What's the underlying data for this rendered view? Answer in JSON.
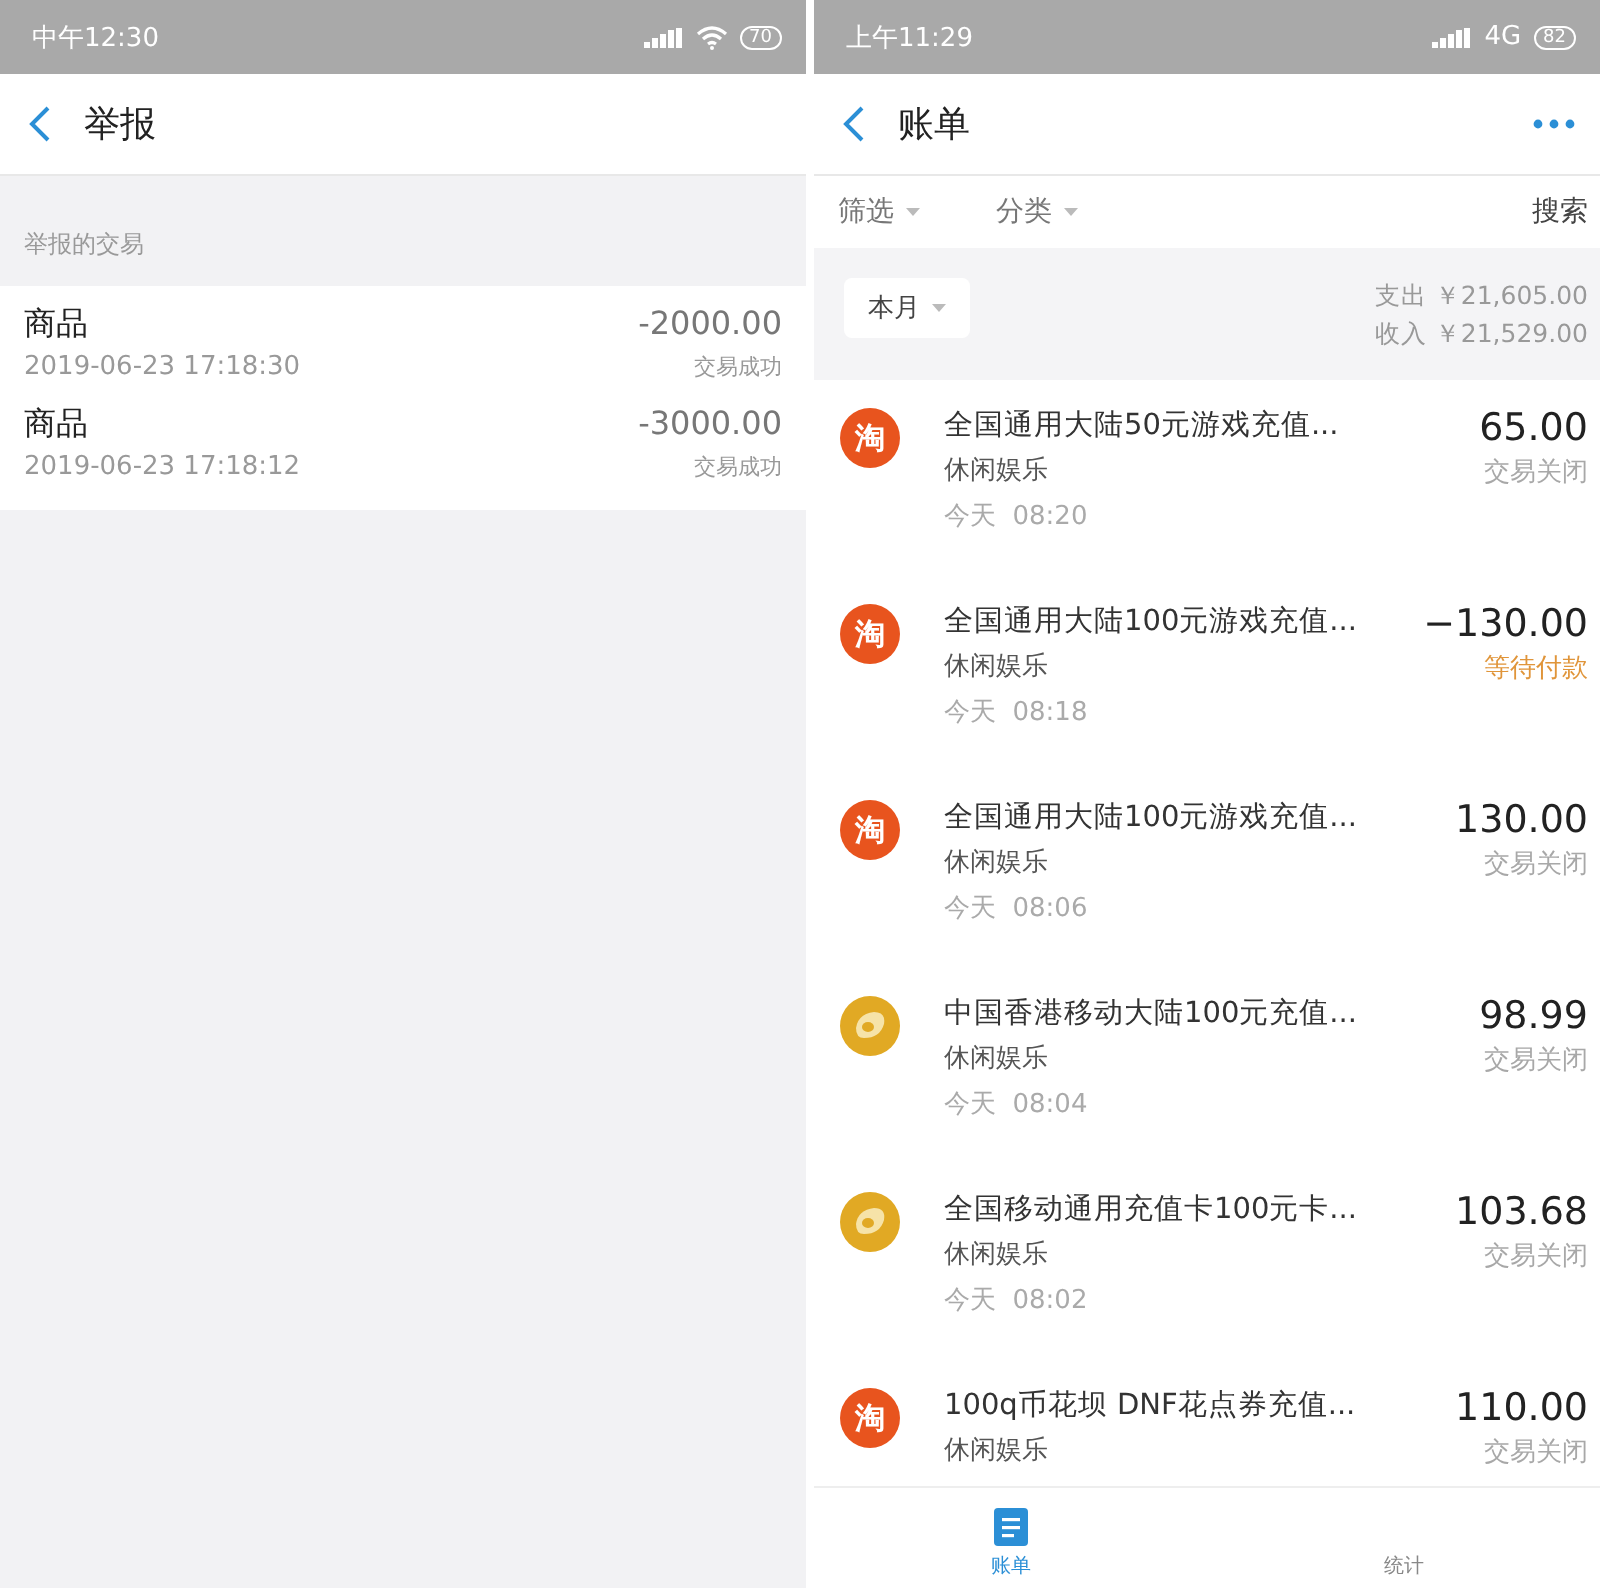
{
  "left": {
    "status_bar": {
      "time": "中午12:30",
      "battery": "70"
    },
    "header": {
      "title": "举报"
    },
    "section_label": "举报的交易",
    "transactions": [
      {
        "name": "商品",
        "time": "2019-06-23 17:18:30",
        "amount": "-2000.00",
        "status": "交易成功"
      },
      {
        "name": "商品",
        "time": "2019-06-23 17:18:12",
        "amount": "-3000.00",
        "status": "交易成功"
      }
    ]
  },
  "right": {
    "status_bar": {
      "time": "上午11:29",
      "network": "4G",
      "battery": "82"
    },
    "header": {
      "title": "账单"
    },
    "filters": [
      {
        "label": "筛选"
      },
      {
        "label": "分类"
      }
    ],
    "search": "搜索",
    "period": "本月",
    "summary": [
      {
        "label": "支出",
        "value": "￥21,605.00"
      },
      {
        "label": "收入",
        "value": "￥21,529.00"
      }
    ],
    "bills": [
      {
        "kind": "logo",
        "logo": "淘",
        "title": "全国通用大陆50元游戏充值...",
        "category": "休闲娱乐",
        "time": "今天  08:20",
        "amount": "65.00",
        "status": "交易关闭",
        "pending": false
      },
      {
        "kind": "logo",
        "logo": "淘",
        "title": "全国通用大陆100元游戏充值...",
        "category": "休闲娱乐",
        "time": "今天  08:18",
        "amount": "−130.00",
        "status": "等待付款",
        "pending": true
      },
      {
        "kind": "logo",
        "logo": "淘",
        "title": "全国通用大陆100元游戏充值...",
        "category": "休闲娱乐",
        "time": "今天  08:06",
        "amount": "130.00",
        "status": "交易关闭",
        "pending": false
      },
      {
        "kind": "coin",
        "title": "中国香港移动大陆100元充值...",
        "category": "休闲娱乐",
        "time": "今天  08:04",
        "amount": "98.99",
        "status": "交易关闭",
        "pending": false
      },
      {
        "kind": "coin",
        "title": "全国移动通用充值卡100元卡...",
        "category": "休闲娱乐",
        "time": "今天  08:02",
        "amount": "103.68",
        "status": "交易关闭",
        "pending": false
      },
      {
        "kind": "logo",
        "logo": "淘",
        "title": "100q币花坝 DNF花点券充值...",
        "category": "休闲娱乐",
        "amount": "110.00",
        "status": "交易关闭",
        "pending": false
      }
    ],
    "tabs": [
      {
        "label": "账单",
        "selected": true
      },
      {
        "label": "统计",
        "selected": false
      }
    ]
  }
}
